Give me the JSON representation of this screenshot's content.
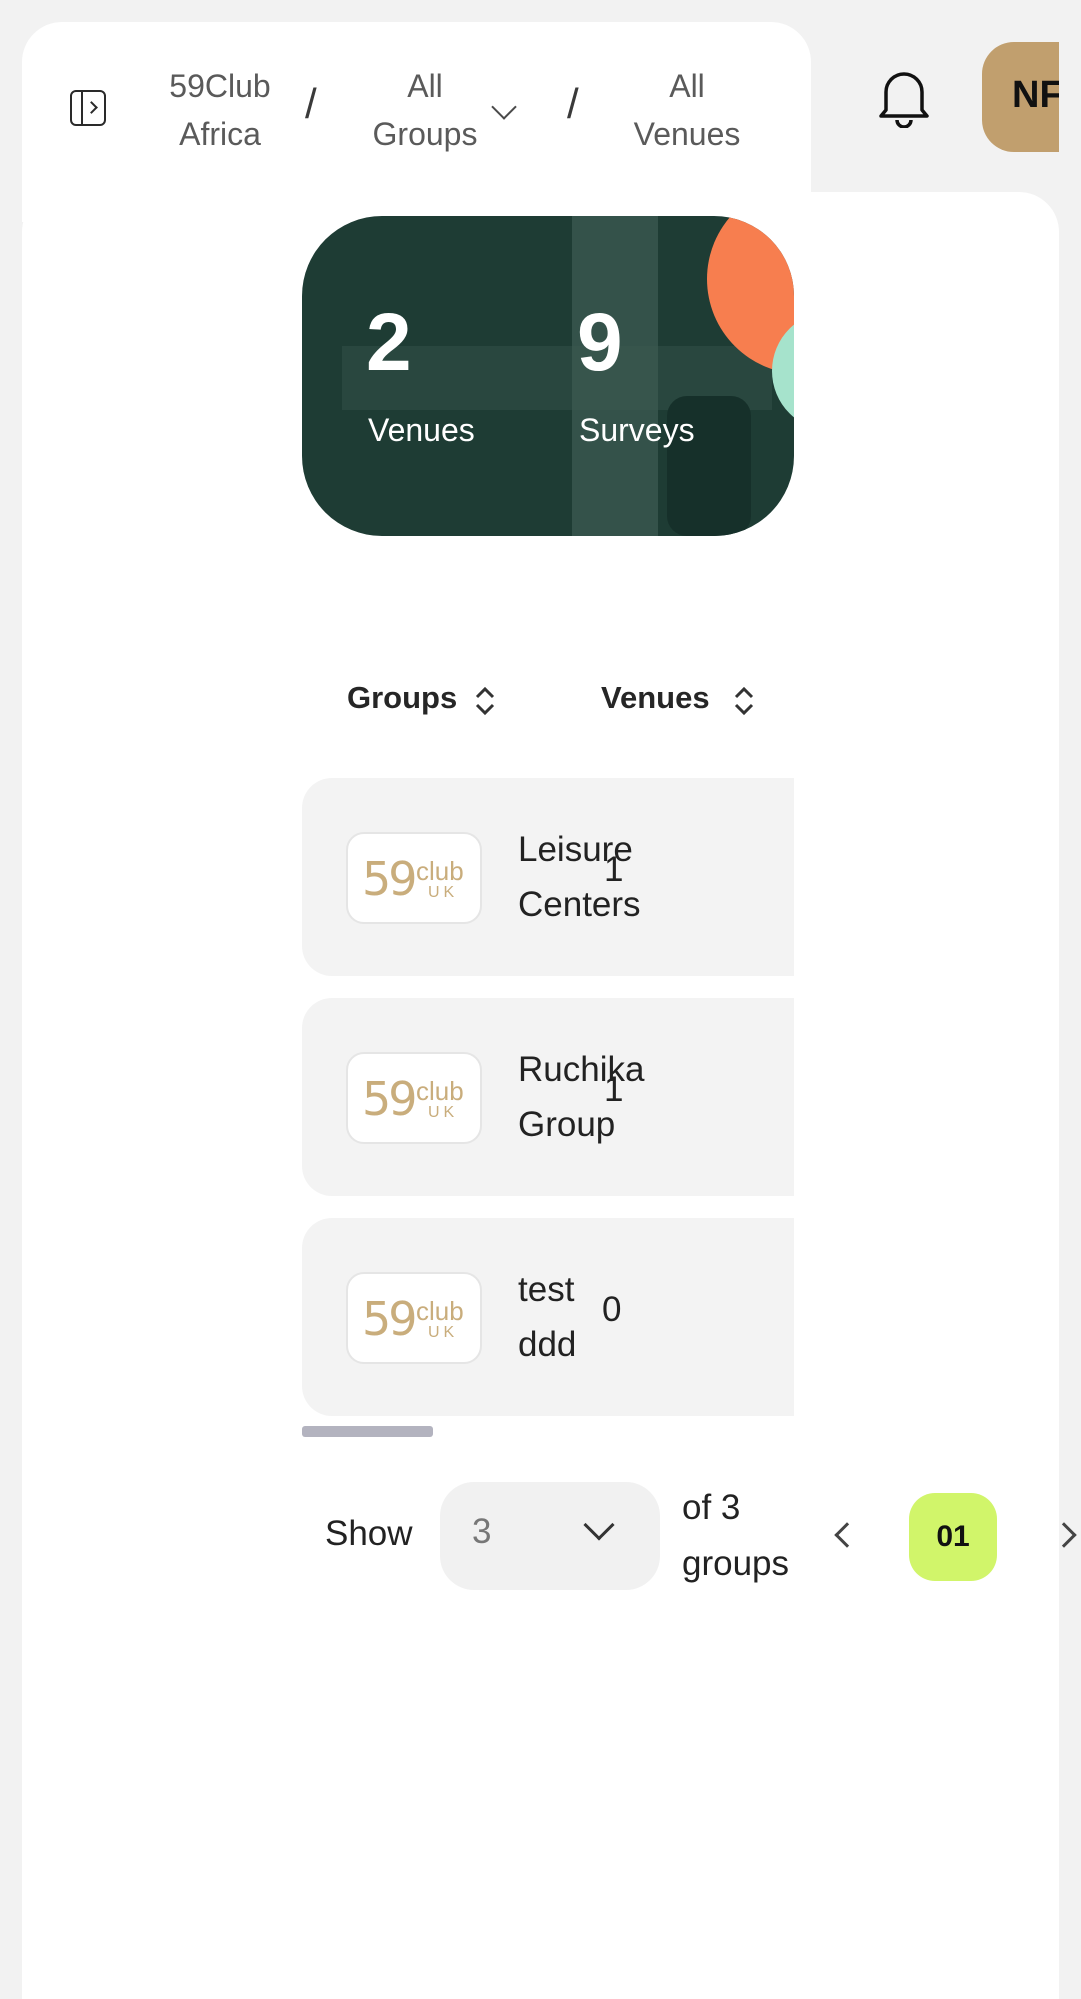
{
  "breadcrumb": {
    "items": [
      {
        "line1": "59Club",
        "line2": "Africa"
      },
      {
        "line1": "All",
        "line2": "Groups"
      },
      {
        "line1": "All",
        "line2": "Venues"
      }
    ],
    "separator": "/"
  },
  "user": {
    "initials": "NF"
  },
  "stats": [
    {
      "value": "2",
      "label": "Venues"
    },
    {
      "value": "9",
      "label": "Surveys"
    }
  ],
  "table": {
    "columns": [
      "Groups",
      "Venues"
    ],
    "rows": [
      {
        "name_line1": "Leisure",
        "name_line2": "Centers",
        "venues": "1"
      },
      {
        "name_line1": "Ruchika",
        "name_line2": "Group",
        "venues": "1"
      },
      {
        "name_line1": "test",
        "name_line2": "ddd",
        "venues": "0"
      }
    ],
    "logo": {
      "num": "59",
      "club": "club",
      "uk": "UK"
    }
  },
  "pagination": {
    "show_label": "Show",
    "page_size": "3",
    "of_line1": "of 3",
    "of_line2": "groups",
    "current_page": "01"
  },
  "colors": {
    "banner": "#1e3c34",
    "accent_lime": "#d1f56a",
    "avatar": "#c19f6e",
    "chart_orange": "#f77e4f",
    "chart_mint": "#a6e3cc"
  }
}
